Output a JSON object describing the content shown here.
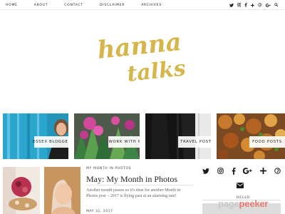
{
  "nav": {
    "items": [
      "HOME",
      "ABOUT",
      "CONTACT",
      "DISCLAIMER",
      "ARCHIVES"
    ]
  },
  "social_top": {
    "icons": [
      "twitter-icon",
      "instagram-icon",
      "facebook-icon",
      "bloglovin-icon",
      "pinterest-icon",
      "google-plus-icon",
      "search-icon"
    ]
  },
  "logo": {
    "line1": "hanna",
    "line2": "talks",
    "color": "#d6b64a"
  },
  "tiles": [
    {
      "label": "ESSEX BLOGGER"
    },
    {
      "label": "WORK WITH ME"
    },
    {
      "label": "TRAVEL POSTS"
    },
    {
      "label": "FOOD POSTS"
    }
  ],
  "post": {
    "category": "MY MONTH IN PHOTOS",
    "title": "May: My Month in Photos",
    "excerpt": "Another month passes so it's time for another Month in Photos post – 2017 is flying past at an alarming rate!",
    "date": "MAY 31, 2017"
  },
  "sidebar": {
    "hello": "HELLO",
    "icons": [
      "twitter-icon",
      "instagram-icon",
      "facebook-icon",
      "google-plus-icon",
      "bloglovin-icon",
      "pinterest-icon",
      "email-icon"
    ]
  },
  "watermark": {
    "part1": "page",
    "part2": "peeker"
  }
}
